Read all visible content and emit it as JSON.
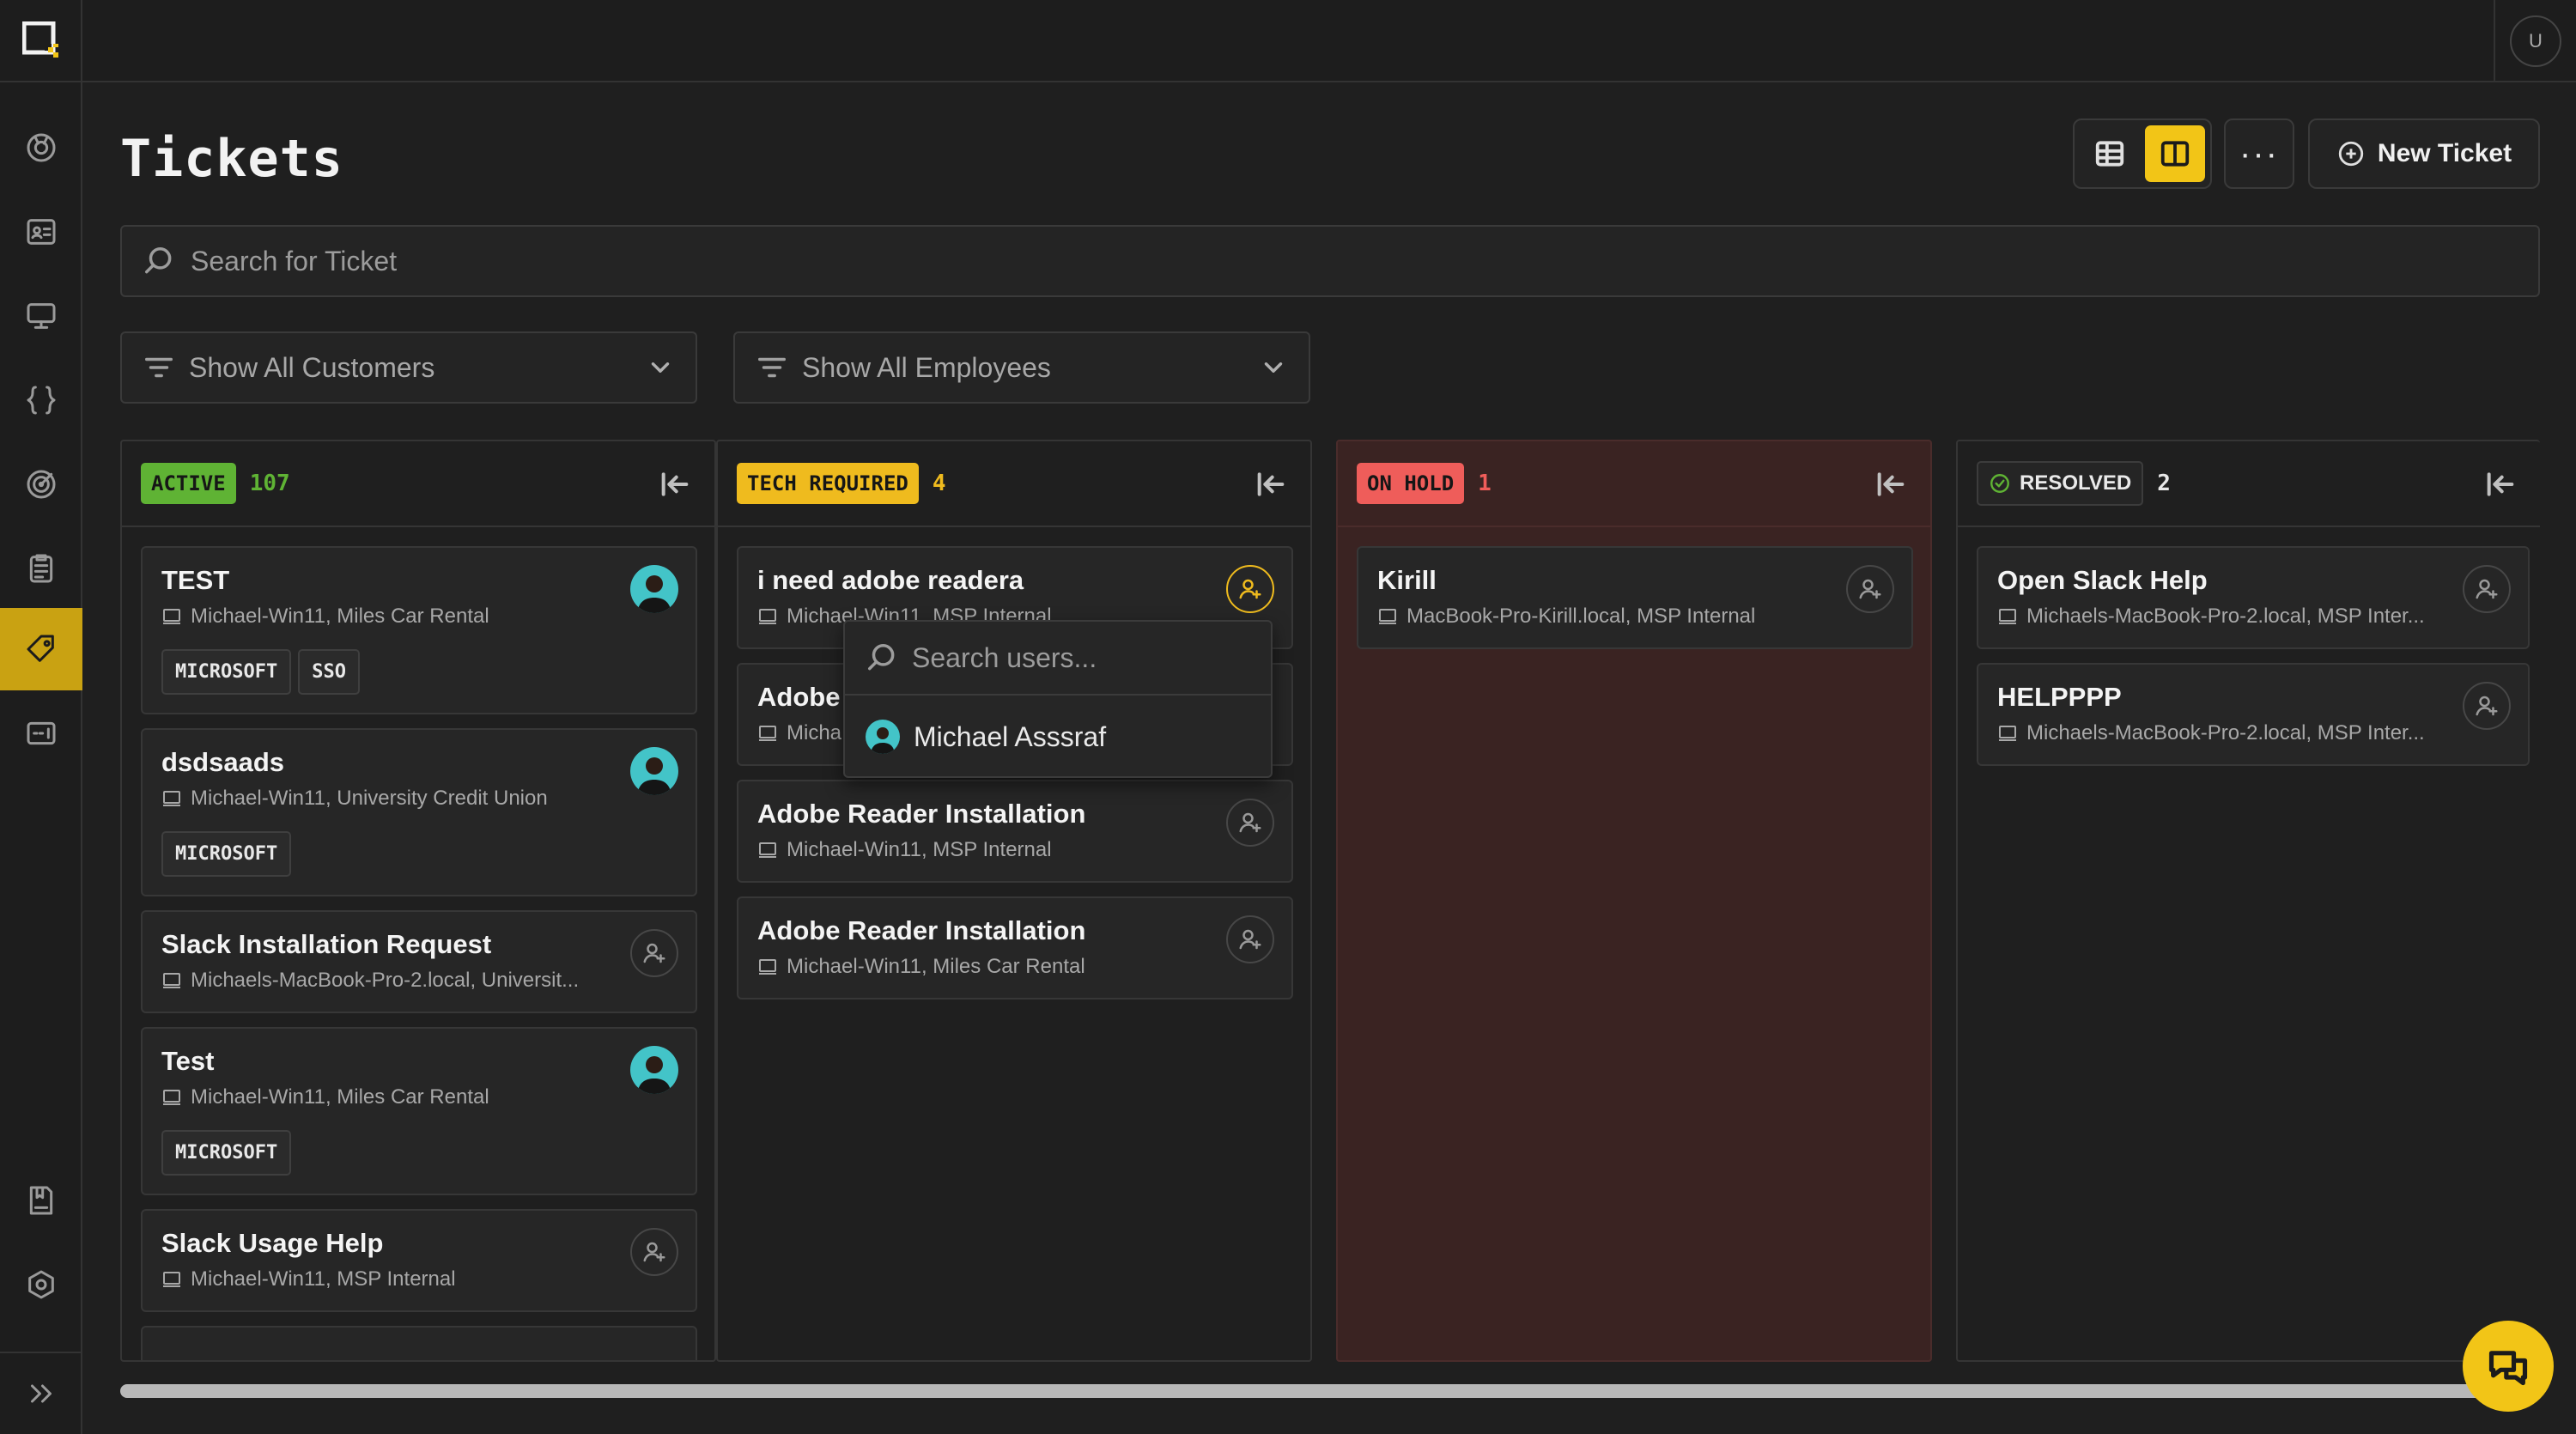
{
  "header": {
    "title": "Tickets",
    "new_ticket_label": "New Ticket",
    "more_label": "···",
    "user_initial": "U"
  },
  "search": {
    "placeholder": "Search for Ticket"
  },
  "filters": {
    "customers": "Show All Customers",
    "employees": "Show All Employees"
  },
  "columns": [
    {
      "status": "ACTIVE",
      "count": "107",
      "color": "#5fb334",
      "cards": [
        {
          "title": "TEST",
          "subtitle": "Michael-Win11, Miles Car Rental",
          "assigned": true,
          "tags": [
            "MICROSOFT",
            "SSO"
          ]
        },
        {
          "title": "dsdsaads",
          "subtitle": "Michael-Win11, University Credit Union",
          "assigned": true,
          "tags": [
            "MICROSOFT"
          ]
        },
        {
          "title": "Slack Installation Request",
          "subtitle": "Michaels-MacBook-Pro-2.local, Universit...",
          "assigned": false,
          "tags": []
        },
        {
          "title": "Test",
          "subtitle": "Michael-Win11, Miles Car Rental",
          "assigned": true,
          "tags": [
            "MICROSOFT"
          ]
        },
        {
          "title": "Slack Usage Help",
          "subtitle": "Michael-Win11, MSP Internal",
          "assigned": false,
          "tags": []
        }
      ]
    },
    {
      "status": "TECH REQUIRED",
      "count": "4",
      "color": "#efbb1e",
      "cards": [
        {
          "title": "i need adobe readera",
          "subtitle": "Michael-Win11, MSP Internal",
          "assigned": false,
          "tags": []
        },
        {
          "title": "Adobe",
          "subtitle": "Micha",
          "assigned": false,
          "tags": []
        },
        {
          "title": "Adobe Reader Installation",
          "subtitle": "Michael-Win11, MSP Internal",
          "assigned": false,
          "tags": []
        },
        {
          "title": "Adobe Reader Installation",
          "subtitle": "Michael-Win11, Miles Car Rental",
          "assigned": false,
          "tags": []
        }
      ]
    },
    {
      "status": "ON HOLD",
      "count": "1",
      "color": "#ef5d5a",
      "cards": [
        {
          "title": "Kirill",
          "subtitle": "MacBook-Pro-Kirill.local, MSP Internal",
          "assigned": false,
          "tags": []
        }
      ]
    },
    {
      "status": "RESOLVED",
      "count": "2",
      "color": "#e8e8e8",
      "cards": [
        {
          "title": "Open Slack Help",
          "subtitle": "Michaels-MacBook-Pro-2.local, MSP Inter...",
          "assigned": false,
          "tags": []
        },
        {
          "title": "HELPPPP",
          "subtitle": "Michaels-MacBook-Pro-2.local, MSP Inter...",
          "assigned": false,
          "tags": []
        }
      ]
    }
  ],
  "assign_popup": {
    "placeholder": "Search users...",
    "users": [
      "Michael Asssraf"
    ]
  },
  "colors": {
    "accent": "#f2c517",
    "background": "#1f1f1f",
    "hold_bg": "#3a2322"
  },
  "icons": [
    "logo-icon",
    "dashboard-icon",
    "contacts-icon",
    "devices-icon",
    "scripts-icon",
    "target-icon",
    "clipboard-icon",
    "tickets-icon",
    "chat-admin-icon",
    "knowledge-icon",
    "settings-icon",
    "expand-icon",
    "table-view-icon",
    "board-view-icon",
    "plus-circle-icon",
    "search-icon",
    "filter-icon",
    "chevron-down-icon",
    "collapse-icon",
    "device-icon",
    "assign-user-icon",
    "check-circle-icon",
    "chat-icon"
  ]
}
